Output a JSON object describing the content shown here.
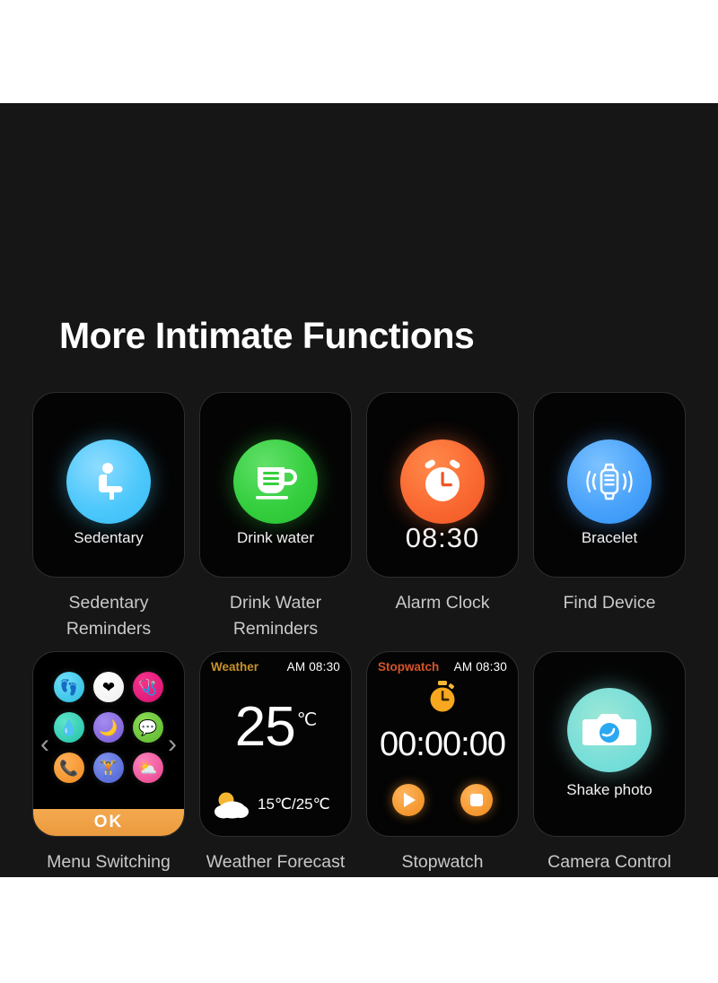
{
  "page": {
    "title": "More Intimate Functions",
    "background": "#161616",
    "panel_color": "#161616"
  },
  "features": [
    {
      "caption": "Sedentary\nReminders",
      "icon_name": "sedentary-person-icon",
      "icon_color": "#4ec8fb",
      "screen_label": "Sedentary"
    },
    {
      "caption": "Drink Water\nReminders",
      "icon_name": "cup-icon",
      "icon_color": "#35cf3f",
      "screen_label": "Drink water"
    },
    {
      "caption": "Alarm Clock",
      "icon_name": "alarm-clock-icon",
      "icon_color": "#fa6a32",
      "screen_label": "08:30"
    },
    {
      "caption": "Find Device",
      "icon_name": "vibrating-watch-icon",
      "icon_color": "#4aa3fb",
      "screen_label": "Bracelet"
    },
    {
      "caption": "Menu Switching",
      "icon_name": "app-grid-icon",
      "ok_label": "OK",
      "prev_icon": "chevron-left-icon",
      "next_icon": "chevron-right-icon",
      "apps": [
        {
          "name": "steps-icon",
          "glyph": "👣",
          "color": "#36c8e8"
        },
        {
          "name": "heart-rate-icon",
          "glyph": "❤",
          "color": "#f4f4f4"
        },
        {
          "name": "blood-pressure-icon",
          "glyph": "🩺",
          "color": "#e8197d"
        },
        {
          "name": "blood-oxygen-icon",
          "glyph": "💧",
          "color": "#2fd0b5"
        },
        {
          "name": "sleep-moon-icon",
          "glyph": "🌙",
          "color": "#8b6ae0"
        },
        {
          "name": "message-icon",
          "glyph": "💬",
          "color": "#6fc93c"
        },
        {
          "name": "phone-icon",
          "glyph": "📞",
          "color": "#f5952f"
        },
        {
          "name": "exercise-icon",
          "glyph": "🏋",
          "color": "#6277e0"
        },
        {
          "name": "weather-app-icon",
          "glyph": "⛅",
          "color": "#ef5fa0"
        }
      ]
    },
    {
      "caption": "Weather Forecast",
      "icon_name": "weather-screen",
      "screen_title": "Weather",
      "screen_title_color": "#c8922a",
      "time": "AM 08:30",
      "temperature": "25",
      "temperature_unit": "℃",
      "range": "15℃/25℃",
      "condition_icon": "sun-behind-cloud-icon"
    },
    {
      "caption": "Stopwatch",
      "icon_name": "stopwatch-screen",
      "screen_title": "Stopwatch",
      "screen_title_color": "#d4552a",
      "time": "AM 08:30",
      "elapsed": "00:00:00",
      "stopwatch_icon": "⏱",
      "start_button": "play-icon",
      "stop_button": "stop-icon"
    },
    {
      "caption": "Camera Control",
      "icon_name": "camera-icon",
      "icon_color": "#7fe0d8",
      "screen_label": "Shake photo"
    }
  ]
}
